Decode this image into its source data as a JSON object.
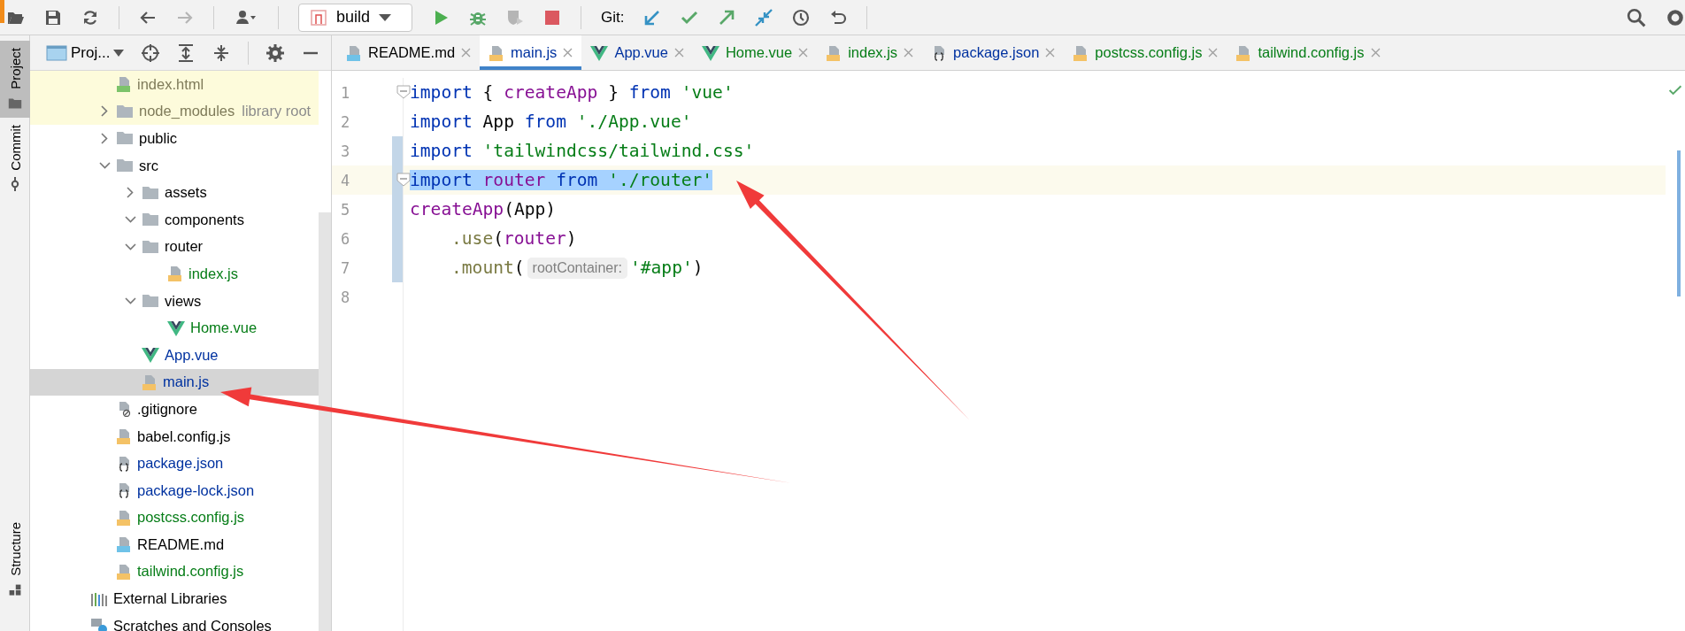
{
  "toolbar": {
    "run_config": "build",
    "git_label": "Git:"
  },
  "tool_stripe": {
    "top": [
      {
        "label": "Project",
        "selected": true
      },
      {
        "label": "Commit",
        "selected": false
      }
    ],
    "bottom": [
      {
        "label": "Structure",
        "selected": false
      }
    ]
  },
  "project_panel": {
    "title": "Proj...",
    "tree": [
      {
        "name": "index.html",
        "kind": "html",
        "color": "#7f7b5a",
        "shaded": true,
        "selected": false
      },
      {
        "name": "node_modules",
        "kind": "folder",
        "color": "#7f7b5a",
        "shaded": true,
        "selected": false,
        "expanded": false,
        "hint": "library root"
      },
      {
        "name": "public",
        "kind": "folder",
        "color": "#000000",
        "shaded": false,
        "selected": false,
        "expanded": false
      },
      {
        "name": "src",
        "kind": "folder",
        "color": "#000000",
        "shaded": false,
        "selected": false,
        "expanded": true,
        "children": [
          {
            "name": "assets",
            "kind": "folder",
            "color": "#000000",
            "shaded": false,
            "selected": false,
            "expanded": false
          },
          {
            "name": "components",
            "kind": "folder",
            "color": "#000000",
            "shaded": false,
            "selected": false,
            "expanded": true
          },
          {
            "name": "router",
            "kind": "folder",
            "color": "#000000",
            "shaded": false,
            "selected": false,
            "expanded": true,
            "children": [
              {
                "name": "index.js",
                "kind": "js",
                "color": "#067d17",
                "shaded": false,
                "selected": false
              }
            ]
          },
          {
            "name": "views",
            "kind": "folder",
            "color": "#000000",
            "shaded": false,
            "selected": false,
            "expanded": true,
            "children": [
              {
                "name": "Home.vue",
                "kind": "vue",
                "color": "#067d17",
                "shaded": false,
                "selected": false
              }
            ]
          },
          {
            "name": "App.vue",
            "kind": "vue",
            "color": "#0032a0",
            "shaded": false,
            "selected": false
          },
          {
            "name": "main.js",
            "kind": "js",
            "color": "#0032a0",
            "shaded": false,
            "selected": true
          }
        ]
      },
      {
        "name": ".gitignore",
        "kind": "gitignore",
        "color": "#000000",
        "shaded": false,
        "selected": false
      },
      {
        "name": "babel.config.js",
        "kind": "js",
        "color": "#000000",
        "shaded": false,
        "selected": false
      },
      {
        "name": "package.json",
        "kind": "json",
        "color": "#0032a0",
        "shaded": false,
        "selected": false
      },
      {
        "name": "package-lock.json",
        "kind": "json",
        "color": "#0032a0",
        "shaded": false,
        "selected": false
      },
      {
        "name": "postcss.config.js",
        "kind": "js",
        "color": "#067d17",
        "shaded": false,
        "selected": false
      },
      {
        "name": "README.md",
        "kind": "md",
        "color": "#000000",
        "shaded": false,
        "selected": false
      },
      {
        "name": "tailwind.config.js",
        "kind": "js",
        "color": "#067d17",
        "shaded": false,
        "selected": false
      }
    ],
    "extras": [
      {
        "name": "External Libraries",
        "kind": "libraries"
      },
      {
        "name": "Scratches and Consoles",
        "kind": "scratches"
      }
    ]
  },
  "editor": {
    "tabs": [
      {
        "label": "README.md",
        "kind": "md",
        "color": "#000000",
        "selected": false
      },
      {
        "label": "main.js",
        "kind": "js",
        "color": "#0032a0",
        "selected": true
      },
      {
        "label": "App.vue",
        "kind": "vue",
        "color": "#0032a0",
        "selected": false
      },
      {
        "label": "Home.vue",
        "kind": "vue",
        "color": "#067d17",
        "selected": false
      },
      {
        "label": "index.js",
        "kind": "js",
        "color": "#067d17",
        "selected": false
      },
      {
        "label": "package.json",
        "kind": "json",
        "color": "#0032a0",
        "selected": false
      },
      {
        "label": "postcss.config.js",
        "kind": "js",
        "color": "#067d17",
        "selected": false
      },
      {
        "label": "tailwind.config.js",
        "kind": "js",
        "color": "#067d17",
        "selected": false
      }
    ],
    "lines": [
      {
        "number": "1",
        "fold": true,
        "changed": false,
        "current": false,
        "selected": false,
        "tokens": [
          {
            "kind": "kw",
            "text": "import "
          },
          {
            "kind": "plain",
            "text": "{ "
          },
          {
            "kind": "fn",
            "text": "createApp"
          },
          {
            "kind": "plain",
            "text": " } "
          },
          {
            "kind": "kw",
            "text": "from "
          },
          {
            "kind": "str",
            "text": "'vue'"
          }
        ]
      },
      {
        "number": "2",
        "fold": false,
        "changed": false,
        "current": false,
        "selected": false,
        "tokens": [
          {
            "kind": "kw",
            "text": "import "
          },
          {
            "kind": "plain",
            "text": "App "
          },
          {
            "kind": "kw",
            "text": "from "
          },
          {
            "kind": "str",
            "text": "'./App.vue'"
          }
        ]
      },
      {
        "number": "3",
        "fold": false,
        "changed": true,
        "current": false,
        "selected": false,
        "tokens": [
          {
            "kind": "kw",
            "text": "import "
          },
          {
            "kind": "str",
            "text": "'tailwindcss/tailwind.css'"
          }
        ]
      },
      {
        "number": "4",
        "fold": true,
        "changed": true,
        "current": true,
        "selected": true,
        "tokens": [
          {
            "kind": "kw",
            "text": "import "
          },
          {
            "kind": "fn",
            "text": "router "
          },
          {
            "kind": "kw",
            "text": "from "
          },
          {
            "kind": "str",
            "text": "'./router'"
          }
        ]
      },
      {
        "number": "5",
        "fold": false,
        "changed": true,
        "current": false,
        "selected": false,
        "tokens": [
          {
            "kind": "fn",
            "text": "createApp"
          },
          {
            "kind": "plain",
            "text": "(App)"
          }
        ]
      },
      {
        "number": "6",
        "fold": false,
        "changed": true,
        "current": false,
        "selected": false,
        "indented": true,
        "tokens": [
          {
            "kind": "method",
            "text": ".use"
          },
          {
            "kind": "plain",
            "text": "("
          },
          {
            "kind": "fn",
            "text": "router"
          },
          {
            "kind": "plain",
            "text": ")"
          }
        ]
      },
      {
        "number": "7",
        "fold": false,
        "changed": true,
        "current": false,
        "selected": false,
        "indented": true,
        "tokens": [
          {
            "kind": "method",
            "text": ".mount"
          },
          {
            "kind": "plain",
            "text": "("
          },
          {
            "kind": "hint",
            "text": "rootContainer:"
          },
          {
            "kind": "str",
            "text": "'#app'"
          },
          {
            "kind": "plain",
            "text": ")"
          }
        ]
      },
      {
        "number": "8",
        "fold": false,
        "changed": false,
        "current": false
      }
    ]
  }
}
